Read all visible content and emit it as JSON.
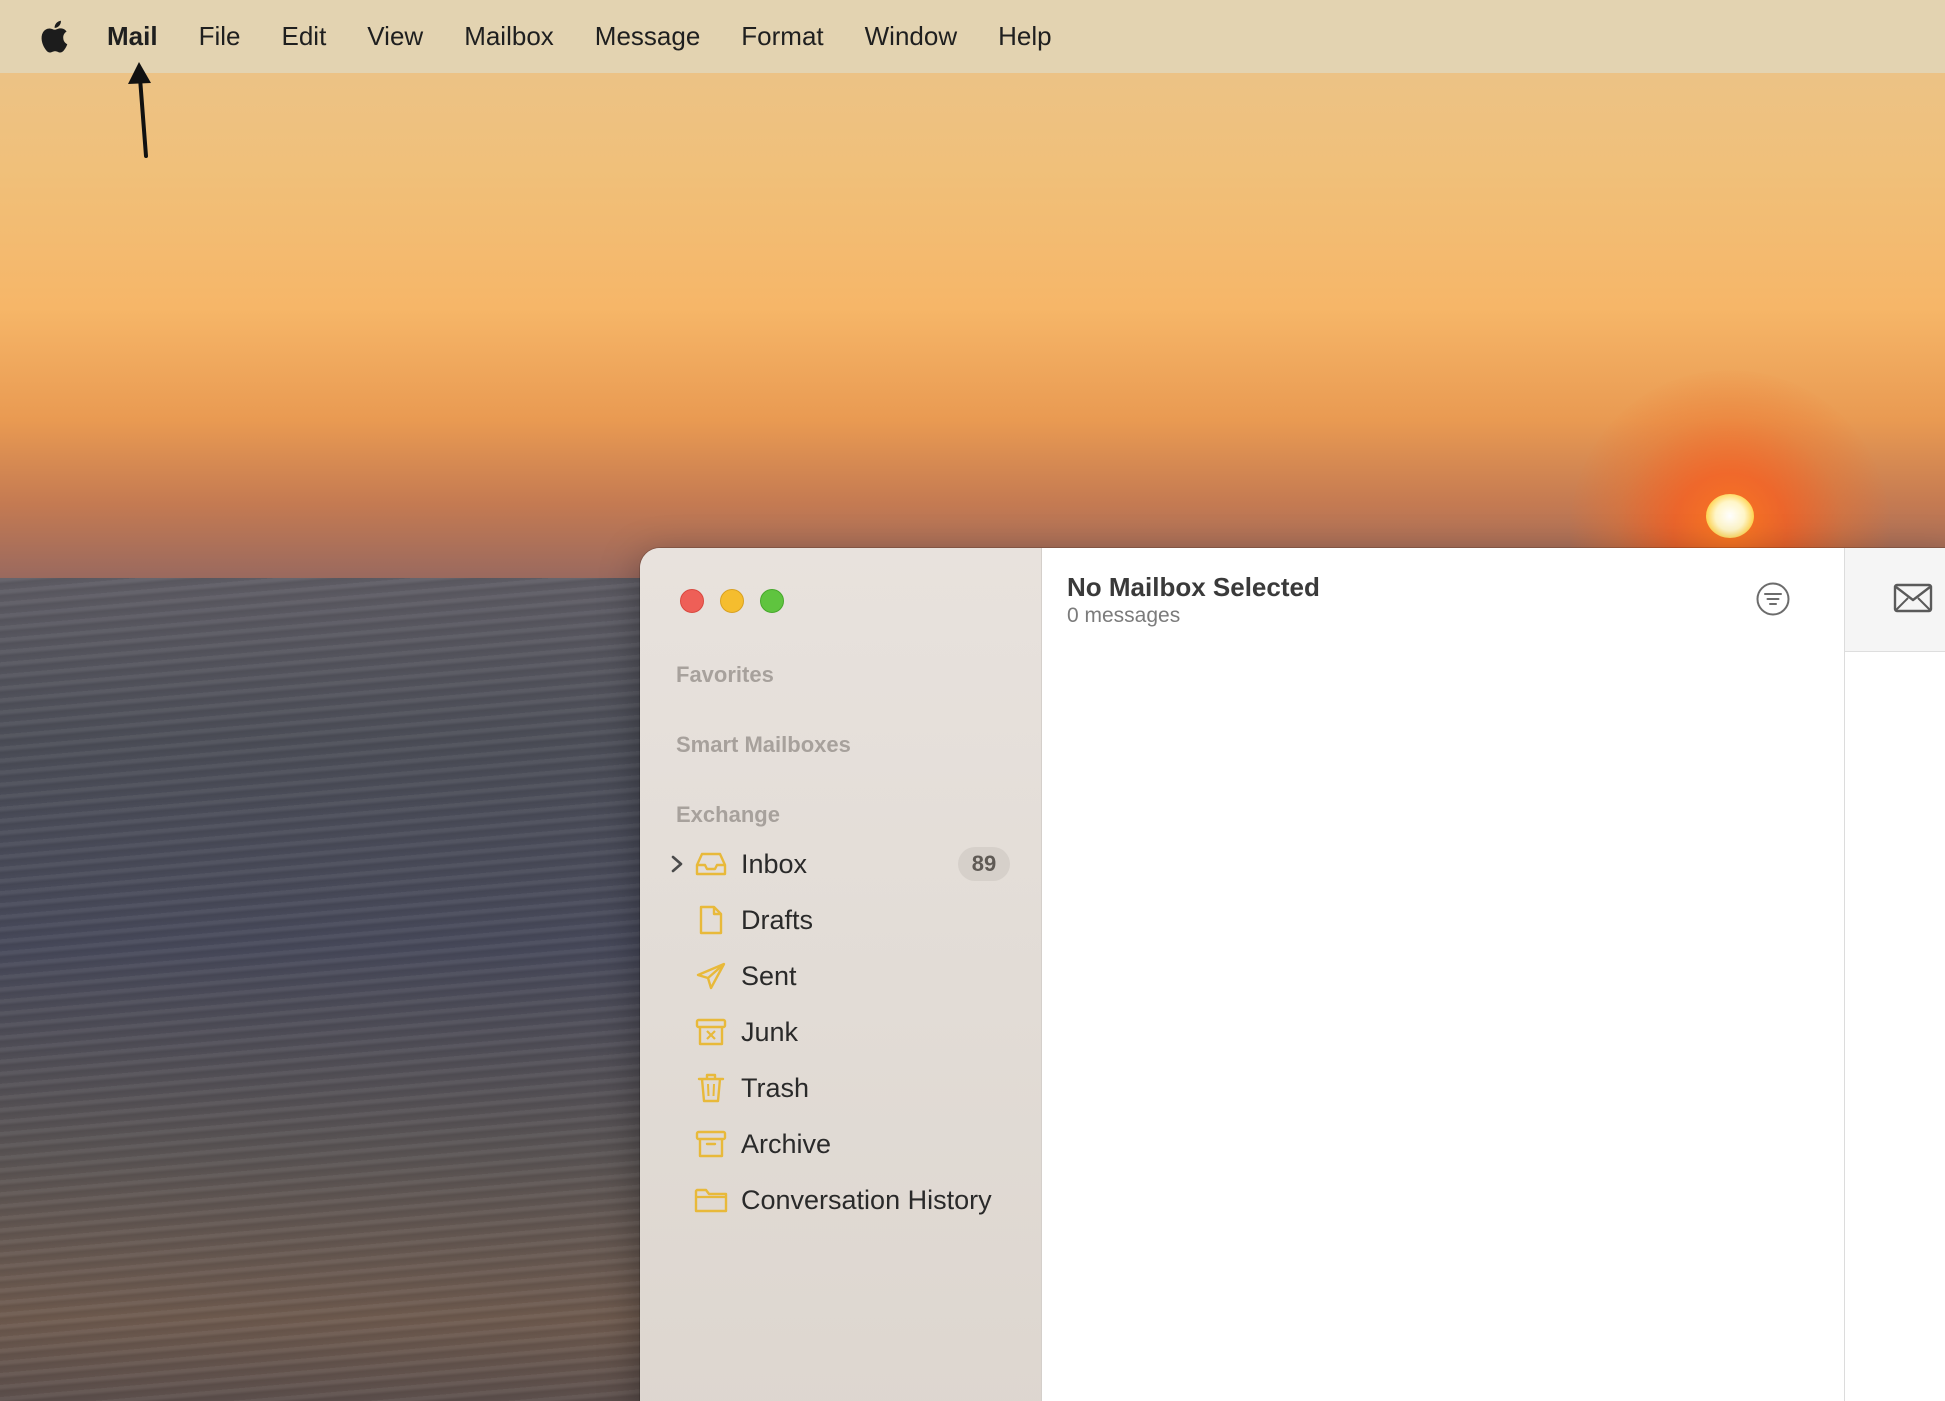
{
  "menubar": {
    "apple_icon": "apple-logo-icon",
    "app_name": "Mail",
    "items": [
      "File",
      "Edit",
      "View",
      "Mailbox",
      "Message",
      "Format",
      "Window",
      "Help"
    ]
  },
  "sidebar": {
    "sections": {
      "favorites": "Favorites",
      "smart_mailboxes": "Smart Mailboxes",
      "exchange": "Exchange"
    },
    "mailboxes": [
      {
        "label": "Inbox",
        "icon": "inbox-tray-icon",
        "badge": "89",
        "expandable": true
      },
      {
        "label": "Drafts",
        "icon": "document-icon"
      },
      {
        "label": "Sent",
        "icon": "paper-plane-icon"
      },
      {
        "label": "Junk",
        "icon": "junk-box-icon"
      },
      {
        "label": "Trash",
        "icon": "trash-icon"
      },
      {
        "label": "Archive",
        "icon": "archive-box-icon"
      },
      {
        "label": "Conversation History",
        "icon": "folder-icon"
      }
    ]
  },
  "message_list": {
    "title": "No Mailbox Selected",
    "count": "0 messages"
  },
  "colors": {
    "menubar_bg": "#e3d3b1",
    "accent_icon": "#e8b93a",
    "close": "#ee5f57",
    "minimize": "#f5bd2e",
    "zoom": "#5fc43f"
  }
}
